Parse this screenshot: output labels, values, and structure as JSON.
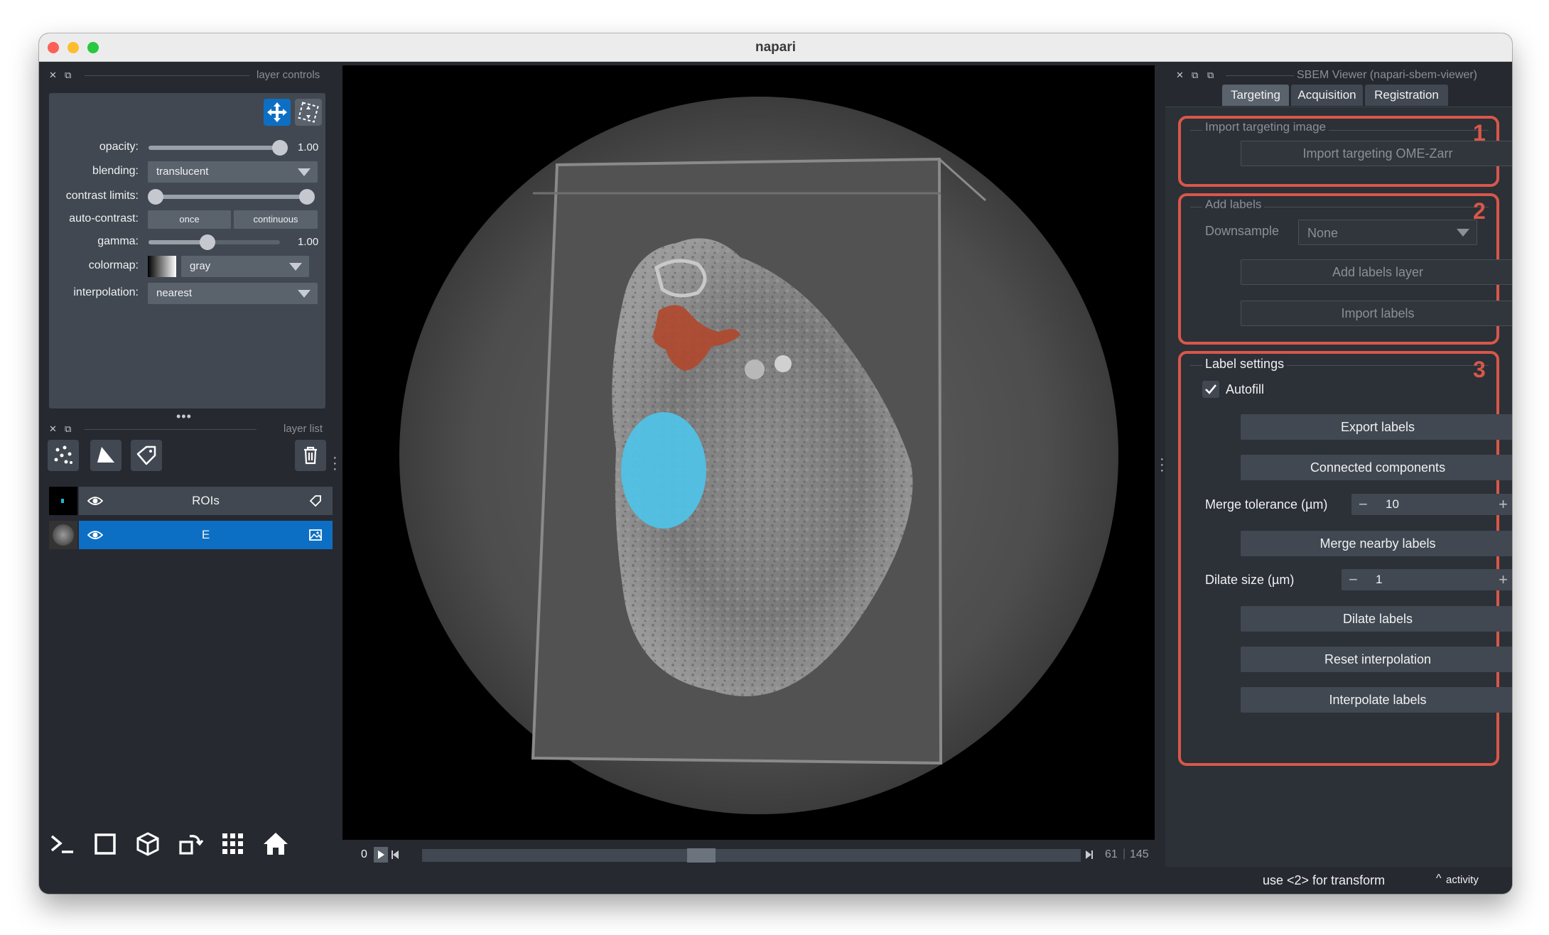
{
  "window": {
    "title": "napari"
  },
  "left": {
    "controls_header": "layer controls",
    "list_header": "layer list",
    "controls": {
      "opacity_label": "opacity:",
      "opacity_value": "1.00",
      "opacity_level": 1.0,
      "blending_label": "blending:",
      "blending_value": "translucent",
      "contrast_label": "contrast limits:",
      "autocontrast_label": "auto-contrast:",
      "once_label": "once",
      "continuous_label": "continuous",
      "gamma_label": "gamma:",
      "gamma_value": "1.00",
      "gamma_level": 0.5,
      "colormap_label": "colormap:",
      "colormap_value": "gray",
      "interpolation_label": "interpolation:",
      "interpolation_value": "nearest"
    },
    "layers": [
      {
        "name": "ROIs",
        "selected": false,
        "type_icon": "labels-tag-icon"
      },
      {
        "name": "E",
        "selected": true,
        "type_icon": "image-icon"
      }
    ]
  },
  "dims": {
    "start": "0",
    "current": "61",
    "total": "145",
    "position": 0.42
  },
  "right": {
    "header": "SBEM Viewer (napari-sbem-viewer)",
    "tabs": [
      {
        "label": "Targeting",
        "active": true
      },
      {
        "label": "Acquisition",
        "active": false
      },
      {
        "label": "Registration",
        "active": false
      }
    ],
    "group1": {
      "title": "Import targeting image",
      "number": "1",
      "import_btn": "Import targeting OME-Zarr"
    },
    "group2": {
      "title": "Add labels",
      "number": "2",
      "downsample_label": "Downsample",
      "downsample_value": "None",
      "add_labels_btn": "Add labels layer",
      "import_labels_btn": "Import labels"
    },
    "group3": {
      "title": "Label settings",
      "number": "3",
      "autofill_label": "Autofill",
      "autofill_checked": true,
      "export_btn": "Export labels",
      "connected_btn": "Connected components",
      "merge_tol_label": "Merge tolerance (µm)",
      "merge_tol_value": "10",
      "merge_btn": "Merge nearby labels",
      "dilate_label": "Dilate size (µm)",
      "dilate_value": "1",
      "dilate_btn": "Dilate labels",
      "reset_btn": "Reset interpolation",
      "interp_btn": "Interpolate labels"
    }
  },
  "status": {
    "hint": "use <2> for transform",
    "activity": "activity"
  },
  "colors": {
    "accent": "#0d6fc3",
    "annotation": "#d8574a",
    "panel": "#262930",
    "control": "#414851"
  }
}
